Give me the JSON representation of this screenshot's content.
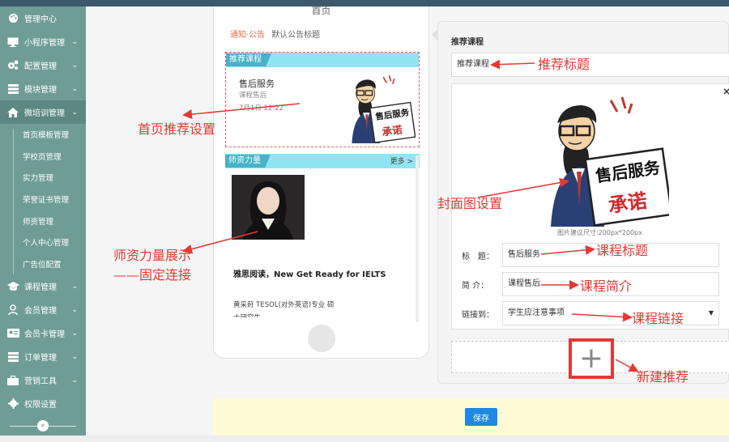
{
  "sidebar": {
    "items": [
      {
        "label": "管理中心",
        "icon": "palette-icon",
        "chevron": false
      },
      {
        "label": "小程序管理",
        "icon": "monitor-icon",
        "chevron": true
      },
      {
        "label": "配置管理",
        "icon": "gears-icon",
        "chevron": true
      },
      {
        "label": "模块管理",
        "icon": "server-icon",
        "chevron": true
      },
      {
        "label": "微培训管理",
        "icon": "home-icon",
        "chevron": true,
        "active": true
      }
    ],
    "subitems": [
      "首页模板管理",
      "学校页管理",
      "实力管理",
      "荣誉证书管理",
      "师资管理",
      "个人中心管理",
      "广告位配置"
    ],
    "items2": [
      {
        "label": "课程管理",
        "icon": "graduation-cap-icon"
      },
      {
        "label": "会员管理",
        "icon": "user-icon"
      },
      {
        "label": "会员卡管理",
        "icon": "id-card-icon"
      },
      {
        "label": "订单管理",
        "icon": "server-icon"
      },
      {
        "label": "营销工具",
        "icon": "briefcase-icon"
      },
      {
        "label": "权限设置",
        "icon": "gear-icon"
      }
    ],
    "collapse_glyph": "«"
  },
  "phone": {
    "title": "首页",
    "notice_label": "通知·公告",
    "notice_text": "默认公告标题",
    "recommend": {
      "tag": "推荐课程",
      "course_title": "售后服务",
      "course_subtitle": "课程售后",
      "course_date": "7月1日 12:22"
    },
    "teachers": {
      "tag": "师资力量",
      "more": "更多 >",
      "name_line": "雅思阅读，New Get Ready for IELTS",
      "desc": "黄采莳 TESOL(对外英语)专业 硕",
      "desc2": "士研究生"
    }
  },
  "panel": {
    "title": "推荐课程",
    "title_input_value": "推荐课程",
    "cover_hint": "图片建议尺寸:200px*200px",
    "fields": {
      "title_label": "标　题：",
      "title_value": "售后服务",
      "intro_label": "简 介：",
      "intro_value": "课程售后",
      "link_label": "链接到：",
      "link_value": "学生应注意事项"
    },
    "close_glyph": "×",
    "add_glyph": "+"
  },
  "cover_image": {
    "text_top": "售后服务",
    "text_bottom": "承诺"
  },
  "save_label": "保存",
  "annotations": {
    "home_recommend": "首页推荐设置",
    "teacher_show_1": "师资力量展示",
    "teacher_show_2": "——固定连接",
    "recommend_title": "推荐标题",
    "cover_setting": "封面图设置",
    "course_title": "课程标题",
    "course_intro": "课程简介",
    "course_link": "课程链接",
    "new_recommend": "新建推荐"
  },
  "colors": {
    "sidebar": "#6f9d96",
    "annotation": "#e53935",
    "tag": "#45b3c9",
    "tag_bar": "#8fe6f2",
    "save": "#1e88e5"
  }
}
